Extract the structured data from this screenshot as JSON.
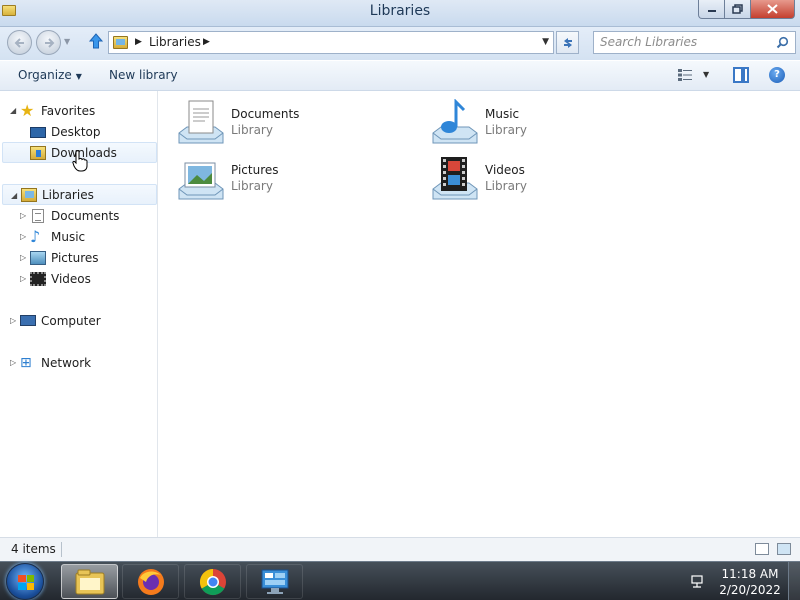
{
  "window": {
    "title": "Libraries"
  },
  "navigation": {
    "breadcrumb": [
      "Libraries"
    ],
    "search_placeholder": "Search Libraries"
  },
  "command_bar": {
    "organize_label": "Organize",
    "new_library_label": "New library"
  },
  "nav_pane": {
    "favorites": {
      "label": "Favorites",
      "items": [
        {
          "label": "Desktop",
          "icon": "desktop-icon"
        },
        {
          "label": "Downloads",
          "icon": "downloads-folder-icon"
        }
      ]
    },
    "libraries": {
      "label": "Libraries",
      "items": [
        {
          "label": "Documents",
          "icon": "documents-icon"
        },
        {
          "label": "Music",
          "icon": "music-icon"
        },
        {
          "label": "Pictures",
          "icon": "pictures-icon"
        },
        {
          "label": "Videos",
          "icon": "videos-icon"
        }
      ]
    },
    "computer": {
      "label": "Computer"
    },
    "network": {
      "label": "Network"
    }
  },
  "content": {
    "libraries": [
      {
        "name": "Documents",
        "type": "Library",
        "icon": "documents-library-icon"
      },
      {
        "name": "Music",
        "type": "Library",
        "icon": "music-library-icon"
      },
      {
        "name": "Pictures",
        "type": "Library",
        "icon": "pictures-library-icon"
      },
      {
        "name": "Videos",
        "type": "Library",
        "icon": "videos-library-icon"
      }
    ]
  },
  "status_bar": {
    "item_count": "4 items"
  },
  "taskbar": {
    "clock_time": "11:18 AM",
    "clock_date": "2/20/2022",
    "pinned": [
      "windows-explorer-icon",
      "firefox-icon",
      "chrome-icon",
      "control-panel-icon"
    ]
  },
  "colors": {
    "accent": "#2e8ae0",
    "titlebar": "#c9daee",
    "close_button": "#c4402f"
  }
}
